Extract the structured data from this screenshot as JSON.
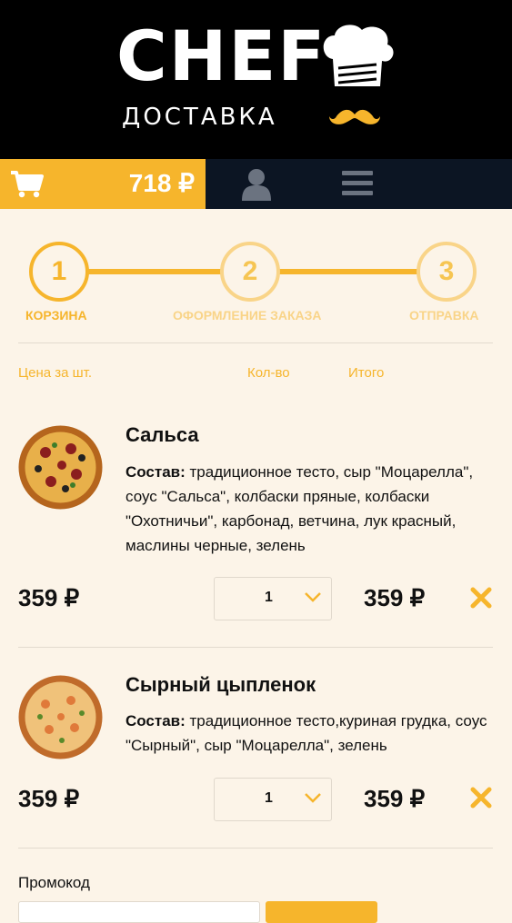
{
  "brand": {
    "logo_word": "CHEF",
    "logo_sub": "ДОСТАВКА"
  },
  "nav": {
    "cart_total": "718 ₽"
  },
  "steps": [
    {
      "number": "1",
      "label": "КОРЗИНА"
    },
    {
      "number": "2",
      "label": "ОФОРМЛЕНИЕ ЗАКАЗА"
    },
    {
      "number": "3",
      "label": "ОТПРАВКА"
    }
  ],
  "columns": {
    "price": "Цена за шт.",
    "qty": "Кол-во",
    "total": "Итого"
  },
  "items": [
    {
      "name": "Сальса",
      "composition_label": "Состав:",
      "composition": " традиционное тесто, сыр \"Моцарелла\", соус \"Сальса\", колбаски пряные, колбаски \"Охотничьи\", карбонад, ветчина, лук красный, маслины черные, зелень",
      "price": "359 ₽",
      "qty": "1",
      "total": "359 ₽"
    },
    {
      "name": "Сырный цыпленок",
      "composition_label": "Состав:",
      "composition": " традиционное тесто,куриная грудка, соус \"Сырный\", сыр \"Моцарелла\", зелень",
      "price": "359 ₽",
      "qty": "1",
      "total": "359 ₽"
    }
  ],
  "promo": {
    "label": "Промокод"
  },
  "colors": {
    "accent": "#f6b52c",
    "nav_bg": "#0c1523",
    "page_bg": "#fcf4e8"
  }
}
